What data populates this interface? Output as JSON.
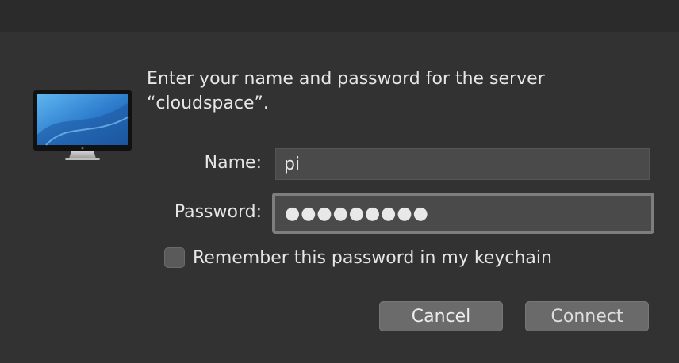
{
  "dialog": {
    "message": "Enter your name and password for the server “cloudspace”."
  },
  "fields": {
    "name_label": "Name:",
    "name_value": "pi",
    "password_label": "Password:",
    "password_value": "●●●●●●●●●"
  },
  "options": {
    "remember_label": "Remember this password in my keychain",
    "remember_checked": false
  },
  "buttons": {
    "cancel": "Cancel",
    "connect": "Connect"
  },
  "icons": {
    "server": "monitor-icon"
  },
  "colors": {
    "background": "#323232",
    "field": "#4a4a4a",
    "button": "#6b6b6b",
    "text": "#e6e6e6"
  }
}
